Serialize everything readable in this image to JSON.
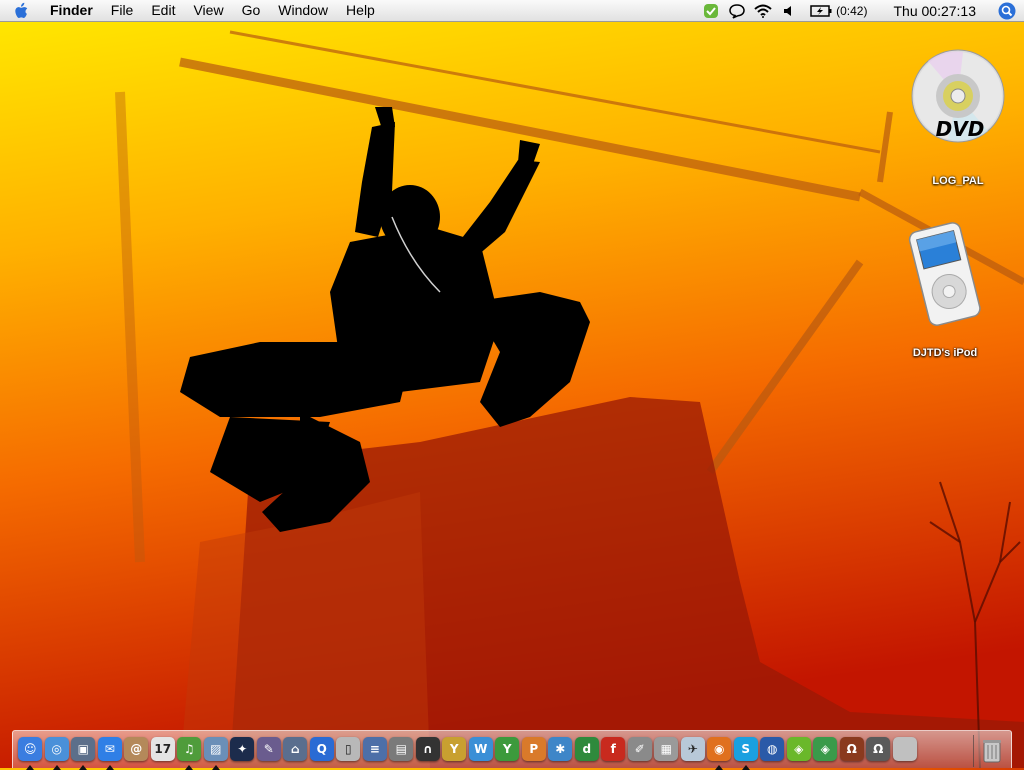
{
  "menubar": {
    "app_name": "Finder",
    "menus": [
      "File",
      "Edit",
      "View",
      "Go",
      "Window",
      "Help"
    ],
    "battery_time": "(0:42)",
    "clock": "Thu 00:27:13"
  },
  "desktop": {
    "icons": [
      {
        "label": "LOG_PAL",
        "icon": "dvd-disc-icon",
        "badge_text": "DVD"
      },
      {
        "label": "DJTD's iPod",
        "icon": "ipod-icon"
      }
    ]
  },
  "dock": {
    "items": [
      {
        "name": "finder",
        "glyph": "☺",
        "color": "#3a7de0",
        "running": true
      },
      {
        "name": "safari",
        "glyph": "◎",
        "color": "#4a90d9",
        "running": true
      },
      {
        "name": "preview",
        "glyph": "▣",
        "color": "#5c6f8a",
        "running": true
      },
      {
        "name": "ichat",
        "glyph": "✉",
        "color": "#2f7fe6",
        "running": true
      },
      {
        "name": "address-book",
        "glyph": "@",
        "color": "#b4895a",
        "running": false
      },
      {
        "name": "ical",
        "glyph": "17",
        "color": "#e4e4e4",
        "running": false
      },
      {
        "name": "itunes",
        "glyph": "♫",
        "color": "#4f9c3b",
        "running": true
      },
      {
        "name": "iphoto",
        "glyph": "▨",
        "color": "#6a8fb8",
        "running": true
      },
      {
        "name": "imovie",
        "glyph": "✦",
        "color": "#1c2c4c",
        "running": false
      },
      {
        "name": "script-editor",
        "glyph": "✎",
        "color": "#6a5c8e",
        "running": false
      },
      {
        "name": "system-profiler",
        "glyph": "⌂",
        "color": "#5a6e8e",
        "running": false
      },
      {
        "name": "quicktime",
        "glyph": "Q",
        "color": "#2a6bd4",
        "running": false
      },
      {
        "name": "ipod-updater",
        "glyph": "▯",
        "color": "#b8b8b8",
        "running": false
      },
      {
        "name": "audio-midi",
        "glyph": "≡",
        "color": "#4d6fa8",
        "running": false
      },
      {
        "name": "keyboard-app",
        "glyph": "▤",
        "color": "#7a7a7a",
        "running": false
      },
      {
        "name": "headphones-app",
        "glyph": "∩",
        "color": "#333333",
        "running": false
      },
      {
        "name": "fan-app",
        "glyph": "Y",
        "color": "#c8a030",
        "running": false
      },
      {
        "name": "dashboard",
        "glyph": "W",
        "color": "#3a8fd6",
        "running": false
      },
      {
        "name": "acquisition",
        "glyph": "Y",
        "color": "#3c9a3c",
        "running": false
      },
      {
        "name": "app-p",
        "glyph": "P",
        "color": "#d97a2a",
        "running": false
      },
      {
        "name": "network-app",
        "glyph": "✱",
        "color": "#3e86c8",
        "running": false
      },
      {
        "name": "dreamweaver",
        "glyph": "d",
        "color": "#2e8a3c",
        "running": false
      },
      {
        "name": "flash",
        "glyph": "f",
        "color": "#c82a1e",
        "running": false
      },
      {
        "name": "editor-app",
        "glyph": "✐",
        "color": "#8a8a8a",
        "running": false
      },
      {
        "name": "photo-browser",
        "glyph": "▦",
        "color": "#9a9a9a",
        "running": false
      },
      {
        "name": "mail-app",
        "glyph": "✈",
        "color": "#b8c8d8",
        "running": false
      },
      {
        "name": "firefox",
        "glyph": "◉",
        "color": "#e0701e",
        "running": true
      },
      {
        "name": "skype",
        "glyph": "S",
        "color": "#1aa0e0",
        "running": true
      },
      {
        "name": "google-earth",
        "glyph": "◍",
        "color": "#2a5aa8",
        "running": false
      },
      {
        "name": "app-green-1",
        "glyph": "◈",
        "color": "#6ab82a",
        "running": false
      },
      {
        "name": "app-green-2",
        "glyph": "◈",
        "color": "#3a9a4a",
        "running": false
      },
      {
        "name": "quake-1",
        "glyph": "Ω",
        "color": "#8a3a1e",
        "running": false
      },
      {
        "name": "quake-2",
        "glyph": "Ω",
        "color": "#5a5a5a",
        "running": false
      },
      {
        "name": "apple-app",
        "glyph": "",
        "color": "#c0c0c0",
        "running": false
      }
    ]
  }
}
